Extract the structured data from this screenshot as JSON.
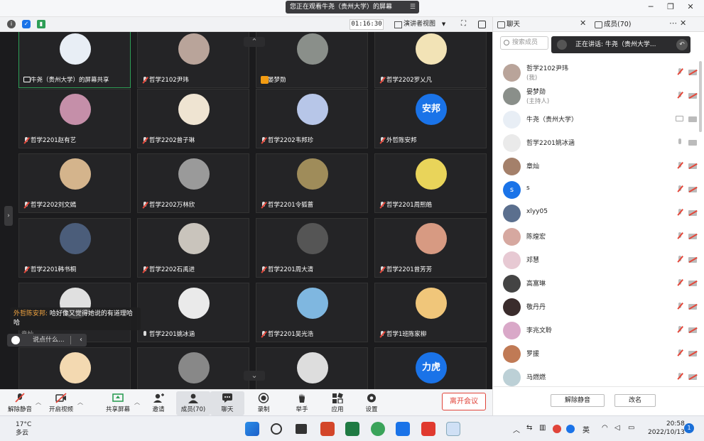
{
  "banner": {
    "text": "您正在观看牛尧（贵州大学）的屏幕"
  },
  "topbar": {
    "timer": "01:16:30",
    "view_label": "演讲者视图"
  },
  "tiles": [
    {
      "name": "牛尧（贵州大学）的屏幕共享",
      "badge": "share",
      "color": "#e8eef5",
      "active": true
    },
    {
      "name": "哲学2102尹玮",
      "badge": "mute",
      "color": "#b9a49a"
    },
    {
      "name": "晏梦勋",
      "badge": "host",
      "color": "#8a8f8a"
    },
    {
      "name": "哲学2202罗乂凡",
      "badge": "mute",
      "color": "#f2e3b6"
    },
    {
      "name": "哲学2201赵有艺",
      "badge": "mute",
      "color": "#c58fa9"
    },
    {
      "name": "哲学2202曾子琳",
      "badge": "mute",
      "color": "#efe4d2"
    },
    {
      "name": "哲学2202韦邦珍",
      "badge": "mute",
      "color": "#b7c6e8"
    },
    {
      "name": "外哲陈安邦",
      "badge": "mute",
      "avatar_text": "安邦"
    },
    {
      "name": "哲学2202刘文嫣",
      "badge": "mute",
      "color": "#d4b48c"
    },
    {
      "name": "哲学2202万林欣",
      "badge": "mute",
      "color": "#9a9a9a"
    },
    {
      "name": "哲学2201令狐蔷",
      "badge": "mute",
      "color": "#9f8c5a"
    },
    {
      "name": "哲学2201周熙皓",
      "badge": "mute",
      "color": "#e9d45a"
    },
    {
      "name": "哲学2201韩书桐",
      "badge": "mute",
      "color": "#4b5d7a"
    },
    {
      "name": "哲学2202石禹进",
      "badge": "mute",
      "color": "#c9c4bc"
    },
    {
      "name": "哲学2201周大清",
      "badge": "mute",
      "color": "#555"
    },
    {
      "name": "哲学2201曾芳芳",
      "badge": "mute",
      "color": "#d79a82"
    },
    {
      "name": "",
      "badge": "",
      "color": "#e0e0e0"
    },
    {
      "name": "哲学2201姚冰涵",
      "badge": "mic",
      "color": "#eaeaea"
    },
    {
      "name": "哲学2201吴光浩",
      "badge": "mute",
      "color": "#7fb7e0"
    },
    {
      "name": "哲学1班陈家柳",
      "badge": "mute",
      "color": "#f0c67a"
    },
    {
      "name": "",
      "badge": "",
      "color": "#f3d9b1"
    },
    {
      "name": "",
      "badge": "",
      "color": "#888"
    },
    {
      "name": "",
      "badge": "",
      "color": "#ddd"
    },
    {
      "name": "",
      "badge": "",
      "avatar_text": "力虎"
    }
  ],
  "chat_popup": {
    "sender": "外哲陈安邦:",
    "message": "哈好像又觉得她说的有道理哈哈"
  },
  "chat_input": {
    "placeholder": "说点什么..."
  },
  "ghost_name": "章灿",
  "toolbar": {
    "unmute": "解除静音",
    "video": "开启视频",
    "share": "共享屏幕",
    "invite": "邀请",
    "members": "成员(70)",
    "chat": "聊天",
    "record": "录制",
    "raise": "举手",
    "apps": "应用",
    "settings": "设置",
    "leave": "离开会议"
  },
  "panel": {
    "chat_tab": "聊天",
    "members_tab": "成员(70)",
    "search_placeholder": "搜索成员",
    "speaking": "正在讲话: 牛尧（贵州大学...",
    "members": [
      {
        "name": "哲学2102尹玮",
        "sub": "(我)",
        "color": "#b9a49a",
        "icons": "mute"
      },
      {
        "name": "晏梦勋",
        "sub": "(主持人)",
        "color": "#8a8f8a",
        "icons": "mute"
      },
      {
        "name": "牛尧（贵州大学）",
        "sub": "",
        "color": "#e8eef5",
        "icons": "share"
      },
      {
        "name": "哲学2201姚冰涵",
        "sub": "",
        "color": "#eaeaea",
        "icons": "mic"
      },
      {
        "name": "章灿",
        "sub": "",
        "color": "#a4806a",
        "icons": "mute"
      },
      {
        "name": "s",
        "sub": "",
        "avatar_text": "s",
        "icons": "mute"
      },
      {
        "name": "xlyy05",
        "sub": "",
        "color": "#5b6f8e",
        "icons": "mute"
      },
      {
        "name": "陈煌宏",
        "sub": "",
        "color": "#d6a8a0",
        "icons": "mute"
      },
      {
        "name": "邓慧",
        "sub": "",
        "color": "#e7c9d3",
        "icons": "mute"
      },
      {
        "name": "高富琳",
        "sub": "",
        "color": "#444",
        "icons": "mute"
      },
      {
        "name": "敬丹丹",
        "sub": "",
        "color": "#3a2c2c",
        "icons": "mute"
      },
      {
        "name": "李兆文聆",
        "sub": "",
        "color": "#d9a8c8",
        "icons": "mute"
      },
      {
        "name": "罗援",
        "sub": "",
        "color": "#c07a55",
        "icons": "mute"
      },
      {
        "name": "马燃燃",
        "sub": "",
        "color": "#bcd0d6",
        "icons": "mute"
      }
    ],
    "unmute_all": "解除静音",
    "rename": "改名"
  },
  "taskbar": {
    "temp": "17°C",
    "weather": "多云",
    "ime": "英",
    "time": "20:58",
    "date": "2022/10/13",
    "notif": "1"
  }
}
